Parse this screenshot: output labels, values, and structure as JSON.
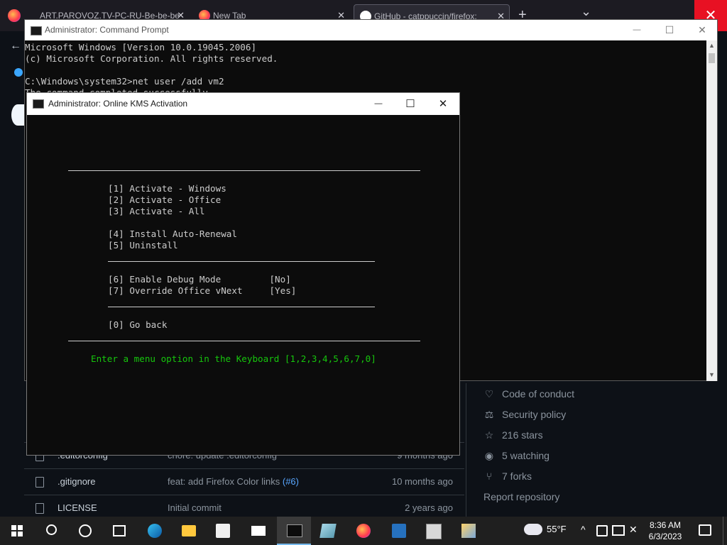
{
  "browser": {
    "tabs": [
      {
        "title": "ART.PAROVOZ.TV-PC-RU-Be-be-be",
        "close": "✕"
      },
      {
        "title": "New Tab",
        "close": "✕"
      },
      {
        "title": "GitHub - catppuccin/firefox: ",
        "close": "✕"
      }
    ],
    "new_tab": "+",
    "list_all": "⌄",
    "close_glyph": "✕",
    "back_glyph": "←"
  },
  "github": {
    "files": [
      {
        "name": ".editorconfig",
        "message": "chore: update .editorconfig",
        "link": "",
        "date": "9 months ago"
      },
      {
        "name": ".gitignore",
        "message": "feat: add Firefox Color links ",
        "link": "(#6)",
        "date": "10 months ago"
      },
      {
        "name": "LICENSE",
        "message": "Initial commit",
        "link": "",
        "date": "2 years ago"
      }
    ],
    "sidebar": [
      {
        "icon": "heart-icon",
        "glyph": "♡",
        "label": "Code of conduct"
      },
      {
        "icon": "scale-icon",
        "glyph": "⚖",
        "label": "Security policy"
      },
      {
        "icon": "star-icon",
        "glyph": "☆",
        "label": "216 stars"
      },
      {
        "icon": "eye-icon",
        "glyph": "◉",
        "label": "5 watching"
      },
      {
        "icon": "fork-icon",
        "glyph": "⑂",
        "label": "7 forks"
      }
    ],
    "report": "Report repository"
  },
  "cmd": {
    "title": "Administrator: Command Prompt",
    "lines": "Microsoft Windows [Version 10.0.19045.2006]\n(c) Microsoft Corporation. All rights reserved.\n\nC:\\Windows\\system32>net user /add vm2\nThe command completed successfully."
  },
  "kms": {
    "title": "Administrator:  Online KMS Activation",
    "items": [
      "[1] Activate - Windows",
      "[2] Activate - Office",
      "[3] Activate - All",
      "[4] Install Auto-Renewal",
      "[5] Uninstall",
      "[6] Enable Debug Mode         [No]",
      "[7] Override Office vNext     [Yes]",
      "[0] Go back"
    ],
    "prompt": "Enter a menu option in the Keyboard [1,2,3,4,5,6,7,0]"
  },
  "window_controls": {
    "minimize": "—",
    "maximize": "☐",
    "close": "✕"
  },
  "taskbar": {
    "weather": "55°F",
    "time": "8:36 AM",
    "date": "6/3/2023"
  },
  "colors": {
    "prompt_green": "#16c60c",
    "close_red": "#e81123"
  }
}
